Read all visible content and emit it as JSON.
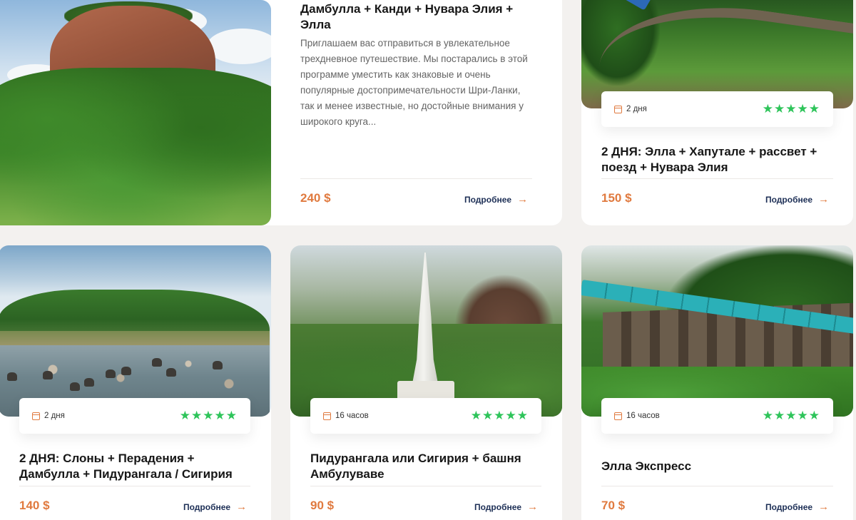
{
  "colors": {
    "accent": "#e07a3f",
    "stars": "#2ec45a",
    "link": "#1d2f56"
  },
  "common": {
    "more_label": "Подробнее",
    "arrow": "→",
    "stars": "★★★★★"
  },
  "cards": [
    {
      "title": "Дамбулла + Канди + Нувара Элия + Элла",
      "description": "Приглашаем вас отправиться в увлекательное трехдневное путешествие. Мы постарались в этой программе уместить как знаковые и очень популярные достопримечательности Шри-Ланки, так и менее известные, но достойные внимания у широкого круга...",
      "price": "240 $"
    },
    {
      "duration": "2 дня",
      "rating": 5,
      "title": "2 ДНЯ: Элла + Хапутале + рассвет + поезд + Нувара Элия",
      "price": "150 $"
    },
    {
      "duration": "2 дня",
      "rating": 5,
      "title": "2 ДНЯ: Слоны + Перадения + Дамбулла + Пидурангала / Сигирия",
      "price": "140 $"
    },
    {
      "duration": "16 часов",
      "rating": 5,
      "title": "Пидурангала или Сигирия + башня Амбулуваве",
      "price": "90 $"
    },
    {
      "duration": "16 часов",
      "rating": 5,
      "title": "Элла Экспресс",
      "price": "70 $"
    }
  ]
}
